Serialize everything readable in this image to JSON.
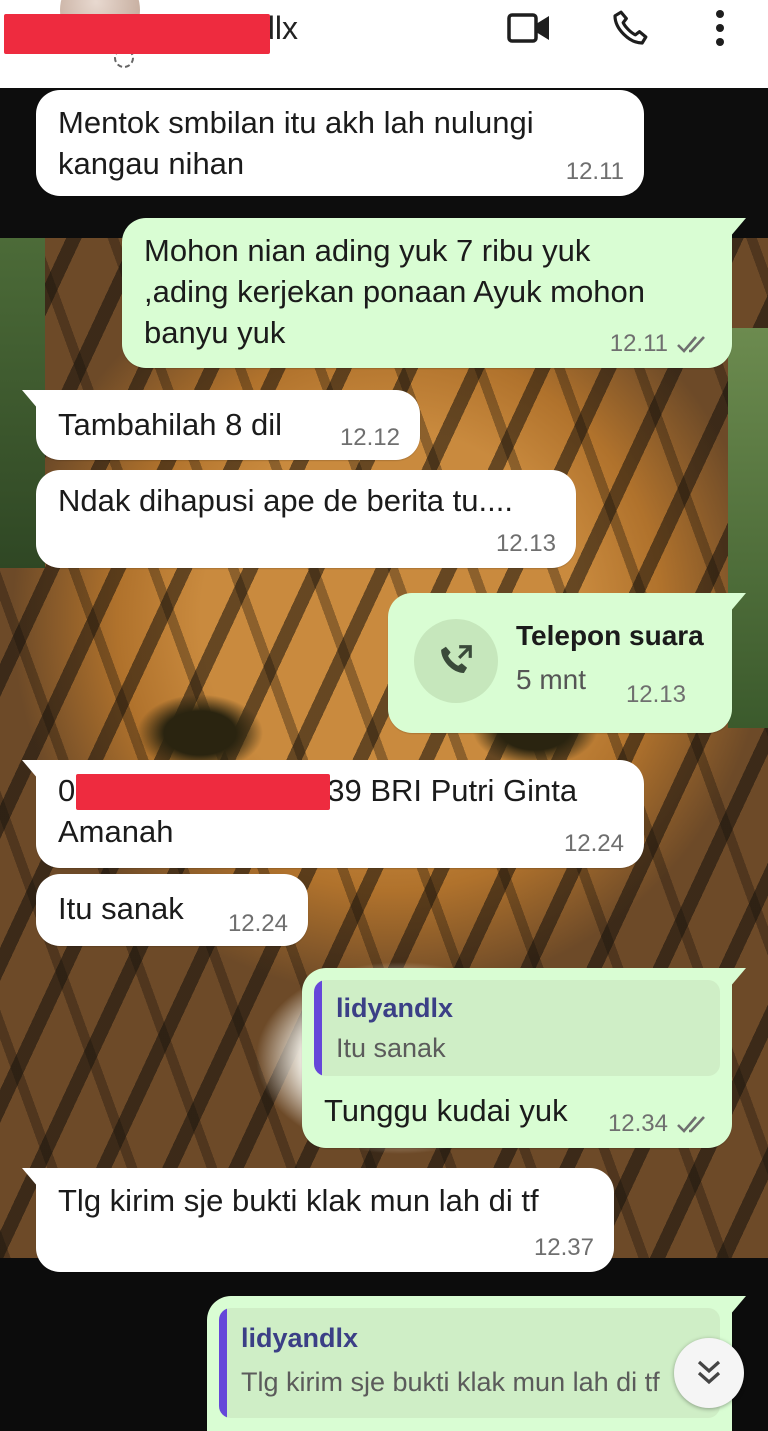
{
  "header": {
    "contact_name": "lidyandlx",
    "icons": [
      "video-call-icon",
      "voice-call-icon",
      "more-options-icon"
    ]
  },
  "messages": [
    {
      "dir": "in",
      "text": "Mentok smbilan itu akh lah nulungi kangau nihan",
      "time": "12.11"
    },
    {
      "dir": "out",
      "text": "Mohon nian ading yuk 7 ribu yuk ,ading kerjekan ponaan Ayuk mohon banyu yuk",
      "time": "12.11",
      "status": "read"
    },
    {
      "dir": "in",
      "text": "Tambahilah 8 dil",
      "time": "12.12"
    },
    {
      "dir": "in",
      "text": "Ndak dihapusi ape de berita tu....",
      "time": "12.13"
    },
    {
      "dir": "out",
      "type": "call",
      "call_title": "Telepon suara",
      "call_duration": "5 mnt",
      "time": "12.13"
    },
    {
      "dir": "in",
      "text_prefix": "0",
      "text_suffix": "39 BRI Putri Ginta",
      "text_line2": "Amanah",
      "time": "12.24"
    },
    {
      "dir": "in",
      "text": "Itu sanak",
      "time": "12.24"
    },
    {
      "dir": "out",
      "quote_author": "lidyandlx",
      "quote_text": "Itu sanak",
      "text": "Tunggu kudai yuk",
      "time": "12.34",
      "status": "read"
    },
    {
      "dir": "in",
      "text": "Tlg kirim sje bukti klak mun lah di tf",
      "time": "12.37"
    },
    {
      "dir": "out",
      "quote_author": "lidyandlx",
      "quote_text": "Tlg kirim sje bukti klak mun lah di tf"
    }
  ],
  "colors": {
    "incoming_bubble": "#ffffff",
    "outgoing_bubble": "#d9fdd3",
    "quote_accent": "#6547d9",
    "redaction": "#ee2b3f"
  }
}
